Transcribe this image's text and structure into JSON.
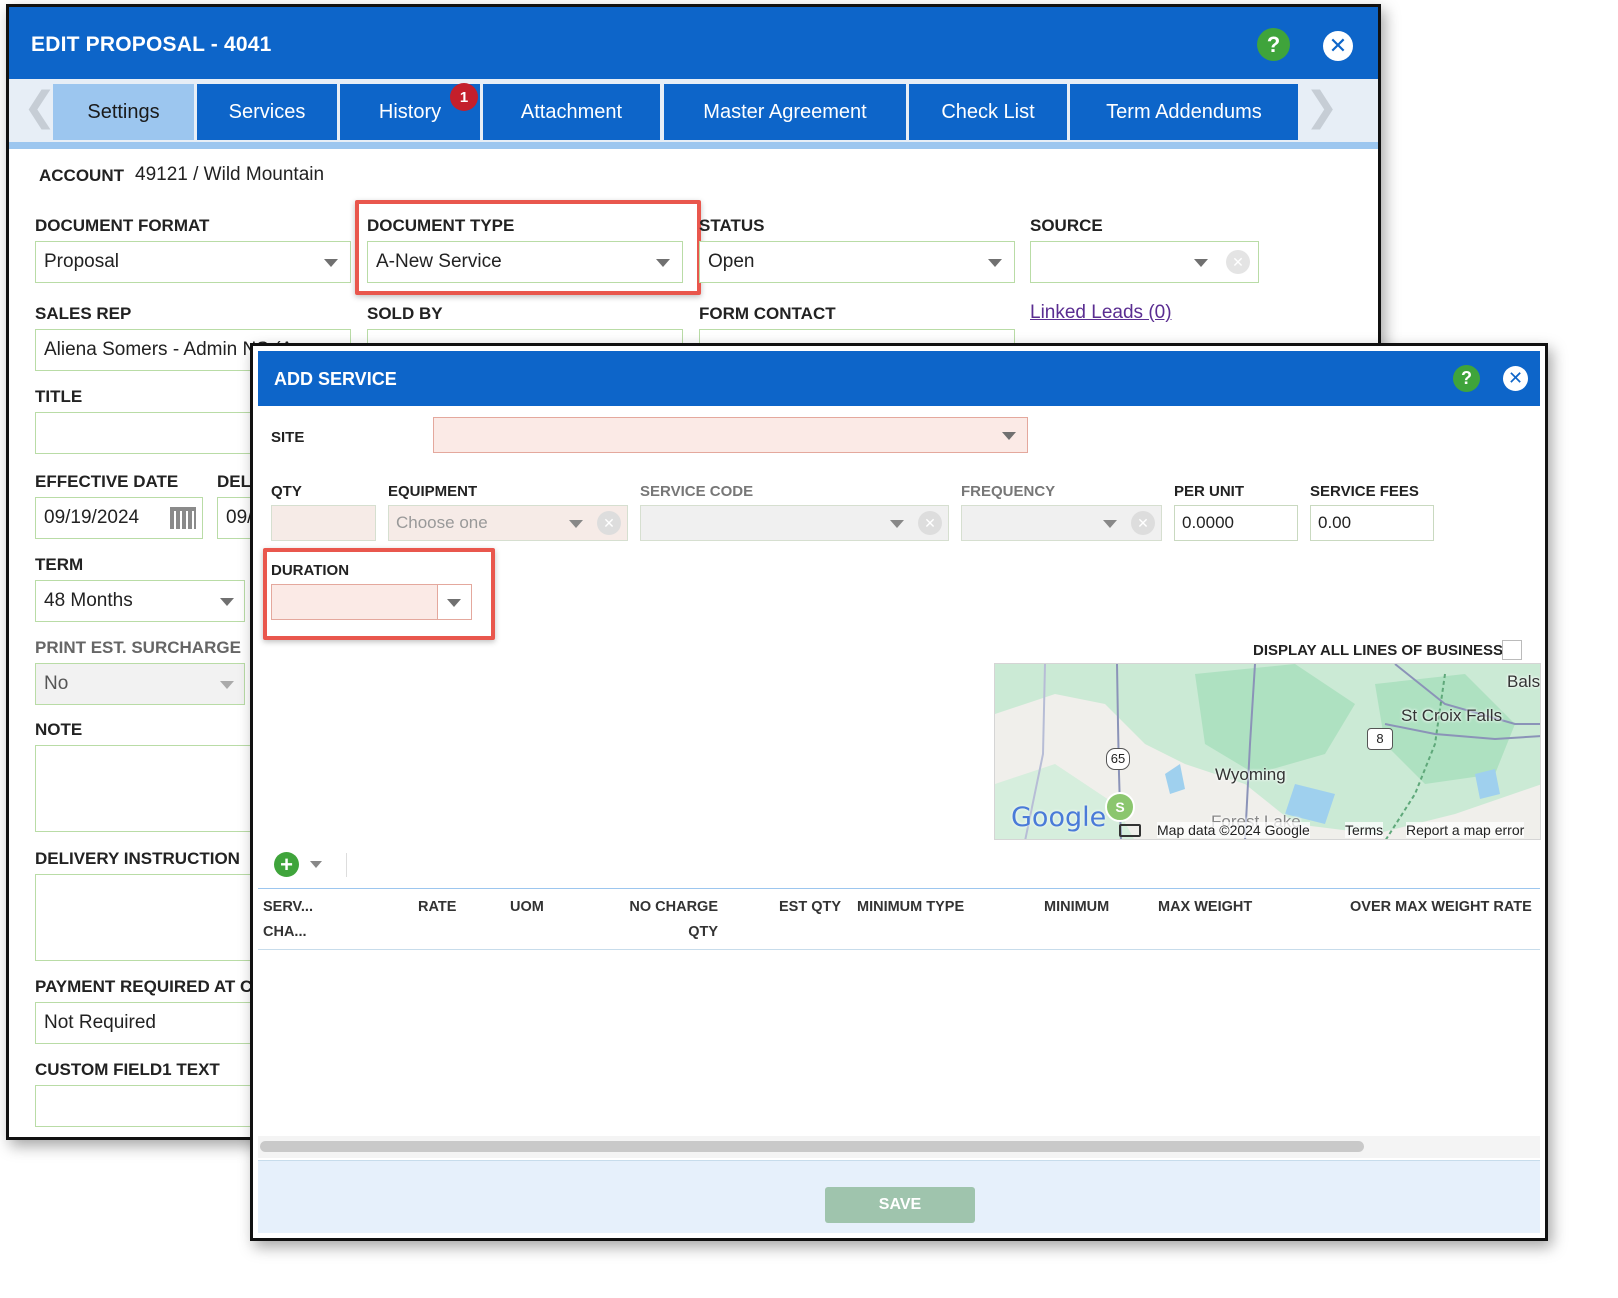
{
  "edit_proposal": {
    "title": "EDIT PROPOSAL - 4041",
    "help_icon": "?",
    "close_icon": "✕",
    "tabs": [
      {
        "label": "Settings",
        "active": true
      },
      {
        "label": "Services"
      },
      {
        "label": "History",
        "badge": "1"
      },
      {
        "label": "Attachment"
      },
      {
        "label": "Master Agreement"
      },
      {
        "label": "Check List"
      },
      {
        "label": "Term Addendums"
      }
    ],
    "tab_prev": "❮",
    "tab_next": "❯",
    "account_label": "ACCOUNT",
    "account_value": "49121 / Wild Mountain",
    "document_format": {
      "label": "DOCUMENT FORMAT",
      "value": "Proposal"
    },
    "document_type": {
      "label": "DOCUMENT TYPE",
      "value": "A-New Service"
    },
    "status": {
      "label": "STATUS",
      "value": "Open"
    },
    "source": {
      "label": "SOURCE",
      "value": ""
    },
    "sales_rep": {
      "label": "SALES REP",
      "value": "Aliena Somers - Admin NS (A"
    },
    "sold_by": {
      "label": "SOLD BY"
    },
    "form_contact": {
      "label": "FORM CONTACT"
    },
    "linked_leads": "Linked Leads (0)",
    "title_field": {
      "label": "TITLE",
      "value": ""
    },
    "effective_date": {
      "label": "EFFECTIVE DATE",
      "value": "09/19/2024"
    },
    "delivery_date": {
      "label": "DEL",
      "value": "09/"
    },
    "term": {
      "label": "TERM",
      "value": "48 Months"
    },
    "print_surcharge": {
      "label": "PRINT EST. SURCHARGE",
      "value": "No"
    },
    "note": {
      "label": "NOTE"
    },
    "delivery_instruction": {
      "label": "DELIVERY INSTRUCTION"
    },
    "payment_required": {
      "label": "PAYMENT REQUIRED AT C",
      "value": "Not Required"
    },
    "custom_field1": {
      "label": "CUSTOM FIELD1 TEXT"
    }
  },
  "add_service": {
    "title": "ADD SERVICE",
    "help_icon": "?",
    "close_icon": "✕",
    "site_label": "SITE",
    "qty_label": "QTY",
    "equipment_label": "EQUIPMENT",
    "equipment_placeholder": "Choose one",
    "service_code_label": "SERVICE CODE",
    "frequency_label": "FREQUENCY",
    "per_unit_label": "PER UNIT",
    "per_unit_value": "0.0000",
    "service_fees_label": "SERVICE FEES",
    "service_fees_value": "0.00",
    "duration_label": "DURATION",
    "display_all_lob_label": "DISPLAY ALL LINES OF BUSINESS",
    "map": {
      "labels": [
        "Bals",
        "St Croix Falls",
        "Wyoming",
        "Forest Lake"
      ],
      "route_65": "65",
      "route_8": "8",
      "marker": "S",
      "google": "Google",
      "map_data": "Map data ©2024 Google",
      "terms": "Terms",
      "report": "Report a map error"
    },
    "add_icon": "+",
    "columns": [
      {
        "line1": "SERV...",
        "line2": "CHA..."
      },
      {
        "line1": "RATE"
      },
      {
        "line1": "UOM"
      },
      {
        "line1": "NO CHARGE",
        "line2": "QTY"
      },
      {
        "line1": "EST QTY"
      },
      {
        "line1": "MINIMUM TYPE"
      },
      {
        "line1": "MINIMUM"
      },
      {
        "line1": "MAX WEIGHT"
      },
      {
        "line1": "OVER MAX WEIGHT RATE"
      }
    ],
    "save_label": "SAVE"
  },
  "colors": {
    "header_blue": "#0d65c9",
    "active_tab": "#9cc6ef",
    "help_green": "#3fa43b",
    "badge_red": "#c41f2b",
    "highlight_red": "#e9574d",
    "save_disabled": "#9fc4ad"
  }
}
